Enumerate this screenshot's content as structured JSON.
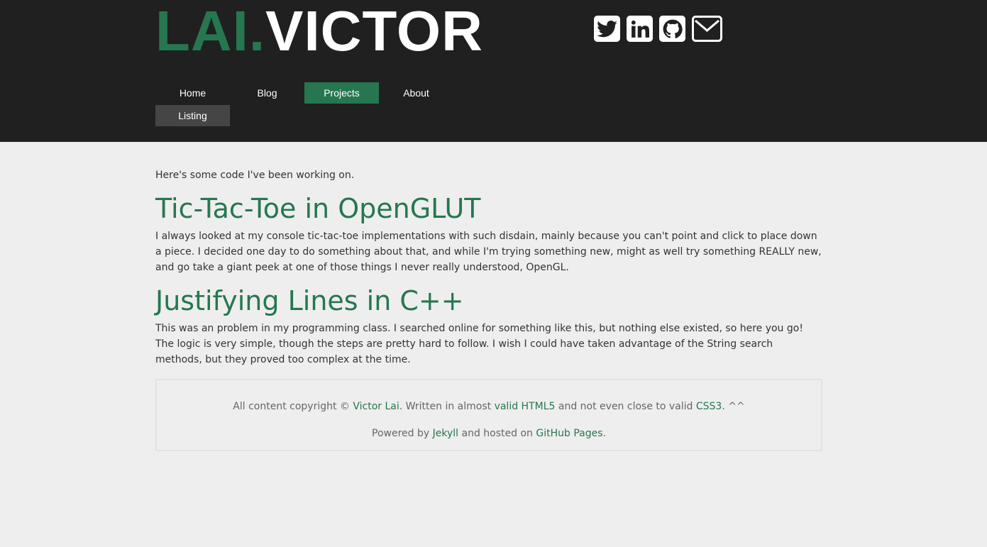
{
  "header": {
    "logo_prefix": "LAI.",
    "logo_name": "VICTOR",
    "social": [
      {
        "name": "twitter-icon"
      },
      {
        "name": "linkedin-icon"
      },
      {
        "name": "github-icon"
      },
      {
        "name": "mail-icon"
      }
    ],
    "nav": {
      "home": "Home",
      "blog": "Blog",
      "projects": "Projects",
      "about": "About",
      "listing": "Listing"
    }
  },
  "main": {
    "intro": "Here's some code I've been working on.",
    "projects": [
      {
        "title": "Tic-Tac-Toe in OpenGLUT",
        "description": "I always looked at my console tic-tac-toe implementations with such disdain, mainly because you can't point and click to place down a piece. I decided one day to do something about that, and while I'm trying something new, might as well try something REALLY new, and go take a giant peek at one of those things I never really understood, OpenGL."
      },
      {
        "title": "Justifying Lines in C++",
        "description": "This was an problem in my programming class. I searched online for something like this, but nothing else existed, so here you go! The logic is very simple, though the steps are pretty hard to follow. I wish I could have taken advantage of the String search methods, but they proved too complex at the time."
      }
    ]
  },
  "footer": {
    "line1_a": "All content copyright © ",
    "author_link": "Victor Lai",
    "line1_b": ". Written in almost ",
    "html5_link": "valid HTML5",
    "line1_c": " and not even close to valid ",
    "css3_link": "CSS3",
    "line1_d": ". ^^",
    "line2_a": "Powered by ",
    "jekyll_link": "Jekyll",
    "line2_b": " and hosted on ",
    "github_link": "GitHub Pages",
    "line2_c": "."
  },
  "colors": {
    "accent": "#26774f",
    "header_bg": "#202020",
    "page_bg": "#eeeeee",
    "listing_bg": "#454545"
  }
}
